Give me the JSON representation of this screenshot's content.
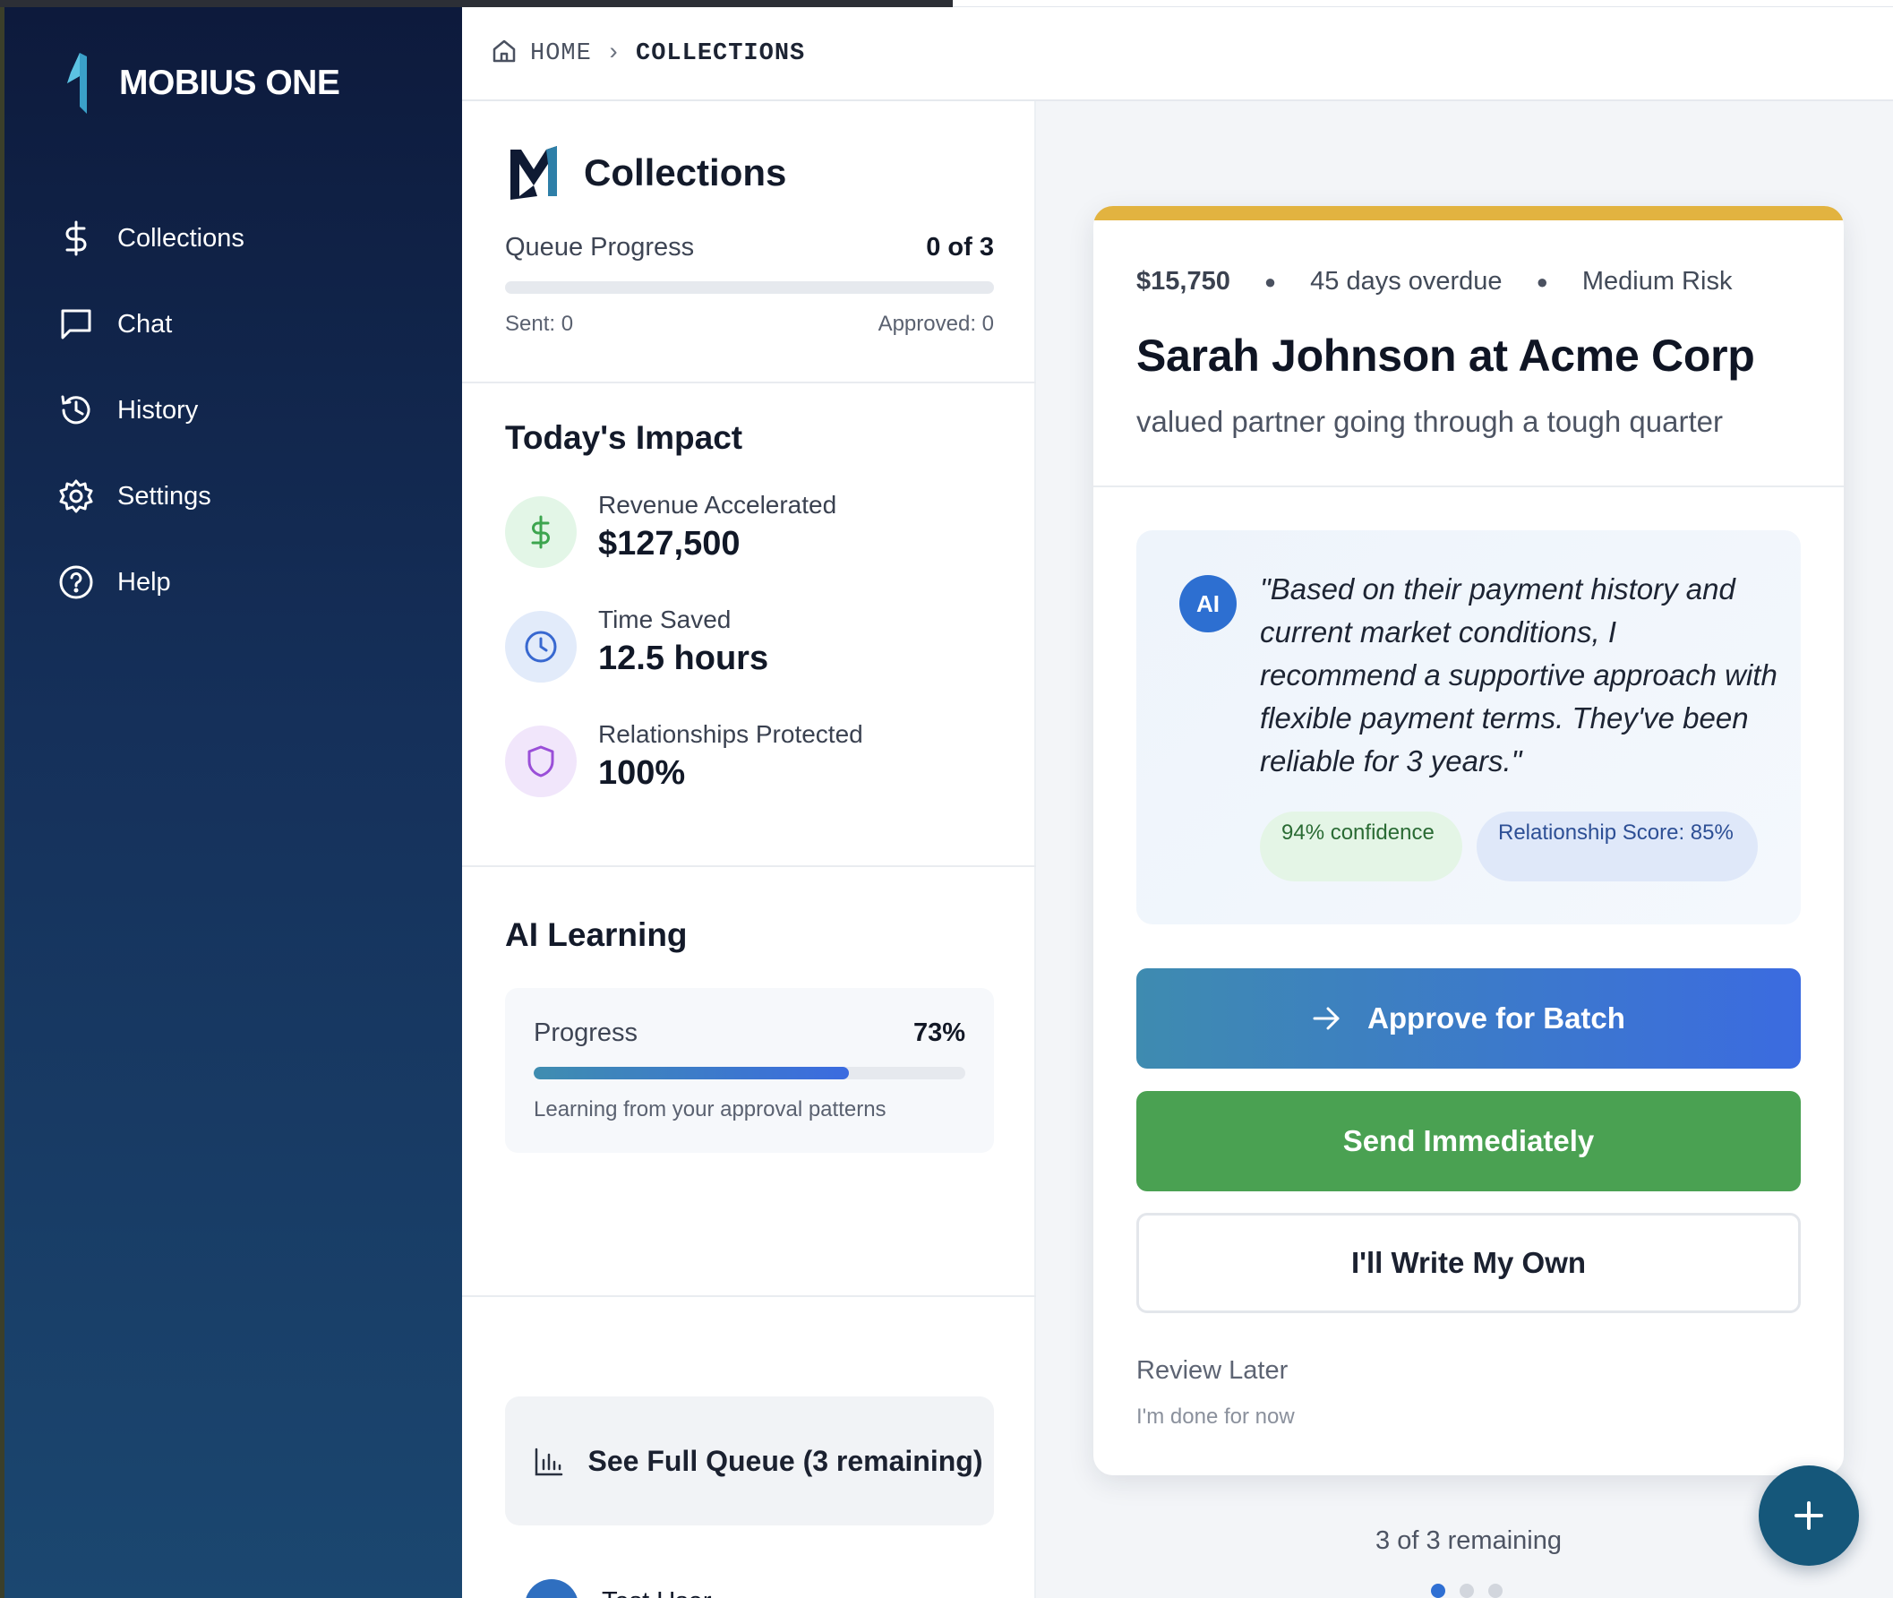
{
  "brand": {
    "name": "MOBIUS ONE"
  },
  "sidebar": {
    "items": [
      {
        "label": "Collections",
        "icon": "dollar-icon"
      },
      {
        "label": "Chat",
        "icon": "chat-icon"
      },
      {
        "label": "History",
        "icon": "history-icon"
      },
      {
        "label": "Settings",
        "icon": "gear-icon"
      },
      {
        "label": "Help",
        "icon": "help-icon"
      }
    ]
  },
  "breadcrumb": {
    "home": "HOME",
    "current": "COLLECTIONS"
  },
  "panel": {
    "title": "Collections",
    "queue_progress": {
      "label": "Queue Progress",
      "value": "0 of 3",
      "fraction": 0,
      "sent": "Sent: 0",
      "approved": "Approved: 0"
    },
    "impact": {
      "title": "Today's Impact",
      "items": [
        {
          "label": "Revenue Accelerated",
          "value": "$127,500",
          "icon": "dollar-icon",
          "color": "#3da54f"
        },
        {
          "label": "Time Saved",
          "value": "12.5 hours",
          "icon": "clock-icon",
          "color": "#3868d0"
        },
        {
          "label": "Relationships Protected",
          "value": "100%",
          "icon": "shield-icon",
          "color": "#9a4fd8"
        }
      ]
    },
    "learning": {
      "title": "AI Learning",
      "label": "Progress",
      "value": "73%",
      "fraction": 0.73,
      "note": "Learning from your approval patterns"
    },
    "queue_button": {
      "label": "See Full Queue (3 remaining)",
      "icon": "bar-chart-icon"
    },
    "user": {
      "name": "Test User"
    }
  },
  "card": {
    "accent": "#e2b340",
    "amount": "$15,750",
    "overdue": "45 days overdue",
    "risk": "Medium Risk",
    "name": "Sarah Johnson at Acme Corp",
    "subtitle": "valued partner going through a tough quarter",
    "ai": {
      "avatar": "AI",
      "quote": "\"Based on their payment history and current market conditions, I recommend a supportive approach with flexible payment terms. They've been reliable for 3 years.\"",
      "confidence": "94% confidence",
      "relationship": "Relationship Score: 85%"
    },
    "buttons": {
      "approve": "Approve for Batch",
      "send": "Send Immediately",
      "write": "I'll Write My Own"
    },
    "review_later": "Review Later",
    "done": "I'm done for now"
  },
  "footer": {
    "remaining": "3 of 3 remaining",
    "dots": 3,
    "active_dot": 0
  },
  "fab": {
    "icon": "plus-icon"
  }
}
